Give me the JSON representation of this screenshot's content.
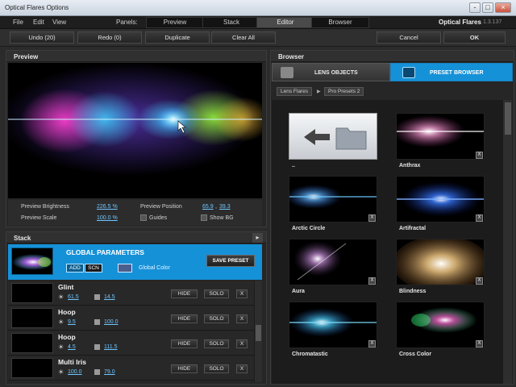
{
  "window": {
    "title": "Optical Flares Options",
    "app_name": "Optical Flares",
    "version": "1.3.137",
    "buttons": [
      "-",
      "□",
      "×"
    ]
  },
  "menu": {
    "items": [
      "File",
      "Edit",
      "View"
    ]
  },
  "panels": {
    "label": "Panels:",
    "tabs": [
      "Preview",
      "Stack",
      "Editor",
      "Browser"
    ],
    "active": "Editor"
  },
  "toolbar": {
    "undo": "Undo (20)",
    "redo": "Redo (0)",
    "duplicate": "Duplicate",
    "clear_all": "Clear All",
    "cancel": "Cancel",
    "ok": "OK"
  },
  "preview": {
    "title": "Preview",
    "brightness_label": "Preview Brightness",
    "brightness_value": "226.5 %",
    "scale_label": "Preview Scale",
    "scale_value": "100.0 %",
    "position_label": "Preview Position",
    "position_x": "65.9",
    "position_sep": ",",
    "position_y": "39.3",
    "guides_label": "Guides",
    "showbg_label": "Show BG"
  },
  "stack": {
    "title": "Stack",
    "arrow": "▸",
    "global": {
      "title": "GLOBAL PARAMETERS",
      "add": "ADD",
      "scn": "SCN",
      "color_label": "Global Color",
      "save_preset": "SAVE PRESET"
    },
    "rows": [
      {
        "name": "Glint",
        "v1": "61.5",
        "v2": "14.5",
        "hide": "HIDE",
        "solo": "SOLO",
        "x": "X"
      },
      {
        "name": "Hoop",
        "v1": "9.5",
        "v2": "100.0",
        "hide": "HIDE",
        "solo": "SOLO",
        "x": "X"
      },
      {
        "name": "Hoop",
        "v1": "4.5",
        "v2": "111.5",
        "hide": "HIDE",
        "solo": "SOLO",
        "x": "X"
      },
      {
        "name": "Multi Iris",
        "v1": "100.0",
        "v2": "79.0",
        "hide": "HIDE",
        "solo": "SOLO",
        "x": "X"
      }
    ],
    "sun_glyph": "☀"
  },
  "browser": {
    "title": "Browser",
    "tab_lens": "LENS OBJECTS",
    "tab_preset": "PRESET BROWSER",
    "crumbs": [
      "Lens Flares",
      "Pro Presets 2"
    ],
    "crumb_arrow": "▶",
    "back_label": "..",
    "tiles": [
      {
        "name": "Anthrax"
      },
      {
        "name": "Arctic Circle"
      },
      {
        "name": "Artifractal"
      },
      {
        "name": "Aura"
      },
      {
        "name": "Blindness"
      },
      {
        "name": "Chromatastic"
      },
      {
        "name": "Cross Color"
      }
    ],
    "x": "X"
  },
  "colors": {
    "accent_blue": "#1591d8",
    "link_blue": "#6fc6ff",
    "panel_bg": "#262626"
  }
}
